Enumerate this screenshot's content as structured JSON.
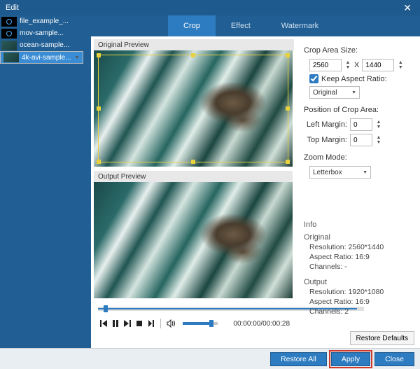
{
  "title": "Edit",
  "sidebar": {
    "items": [
      {
        "label": "file_example_..."
      },
      {
        "label": "mov-sample..."
      },
      {
        "label": "ocean-sample..."
      },
      {
        "label": "4k-avi-sample..."
      }
    ]
  },
  "tabs": [
    {
      "label": "Crop"
    },
    {
      "label": "Effect"
    },
    {
      "label": "Watermark"
    }
  ],
  "preview": {
    "original_label": "Original Preview",
    "output_label": "Output Preview"
  },
  "player": {
    "time": "00:00:00/00:00:28"
  },
  "settings": {
    "crop_area_size_label": "Crop Area Size:",
    "width": "2560",
    "size_sep": "X",
    "height": "1440",
    "keep_aspect_label": "Keep Aspect Ratio:",
    "keep_aspect_checked": true,
    "aspect_select": "Original",
    "position_label": "Position of Crop Area:",
    "left_margin_label": "Left Margin:",
    "left_margin": "0",
    "top_margin_label": "Top Margin:",
    "top_margin": "0",
    "zoom_label": "Zoom Mode:",
    "zoom_select": "Letterbox"
  },
  "info": {
    "header": "Info",
    "original": {
      "label": "Original",
      "resolution": "Resolution: 2560*1440",
      "aspect": "Aspect Ratio: 16:9",
      "channels": "Channels: -"
    },
    "output": {
      "label": "Output",
      "resolution": "Resolution: 1920*1080",
      "aspect": "Aspect Ratio: 16:9",
      "channels": "Channels: 2"
    }
  },
  "buttons": {
    "restore_defaults": "Restore Defaults",
    "restore_all": "Restore All",
    "apply": "Apply",
    "close": "Close"
  }
}
